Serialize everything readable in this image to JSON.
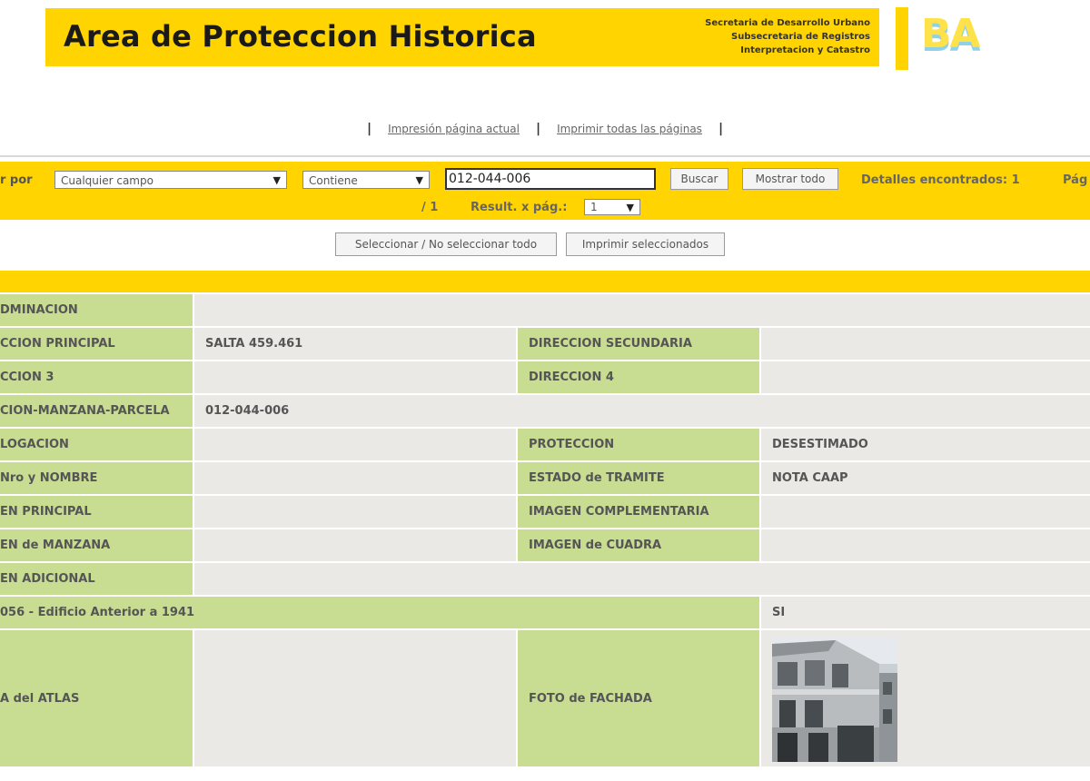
{
  "header": {
    "title": "Area de Proteccion Historica",
    "org_lines": [
      "Secretaria de Desarrollo Urbano",
      "Subsecretaria de Registros",
      "Interpretacion y Catastro"
    ],
    "logo_text": "BA"
  },
  "print_links": {
    "current_page": "Impresión página actual",
    "all_pages": "Imprimir todas las páginas",
    "separator": "|"
  },
  "search": {
    "by_label": "r por",
    "field_select": "Cualquier campo",
    "operator_select": "Contiene",
    "query": "012-044-006",
    "search_button": "Buscar",
    "show_all_button": "Mostrar todo",
    "found_text": "Detalles encontrados: 1",
    "page_label": "Pág",
    "page_total": "/ 1",
    "results_per_page_label": "Result. x pág.:",
    "results_per_page_value": "1"
  },
  "actions": {
    "toggle_select": "Seleccionar / No seleccionar todo",
    "print_selected": "Imprimir seleccionados"
  },
  "record": {
    "denominacion_label": "DMINACION",
    "dir_principal_label": "CCION PRINCIPAL",
    "dir_principal_value": "SALTA 459.461",
    "dir_secundaria_label": "DIRECCION SECUNDARIA",
    "dir_secundaria_value": "",
    "dir3_label": "CCION 3",
    "dir3_value": "",
    "dir4_label": "DIRECCION 4",
    "dir4_value": "",
    "smp_label": "CION-MANZANA-PARCELA",
    "smp_value": "012-044-006",
    "catalogacion_label": "LOGACION",
    "catalogacion_value": "",
    "proteccion_label": "PROTECCION",
    "proteccion_value": "DESESTIMADO",
    "nro_nombre_label": "Nro y NOMBRE",
    "nro_nombre_value": "",
    "estado_tramite_label": "ESTADO de TRAMITE",
    "estado_tramite_value": "NOTA CAAP",
    "img_principal_label": "EN PRINCIPAL",
    "img_complementaria_label": "IMAGEN COMPLEMENTARIA",
    "img_manzana_label": "EN de MANZANA",
    "img_cuadra_label": "IMAGEN de CUADRA",
    "img_adicional_label": "EN ADICIONAL",
    "edificio_label": "056 - Edificio Anterior a 1941",
    "edificio_value": "SI",
    "atlas_label": "A del ATLAS",
    "fachada_label": "FOTO de FACHADA"
  }
}
